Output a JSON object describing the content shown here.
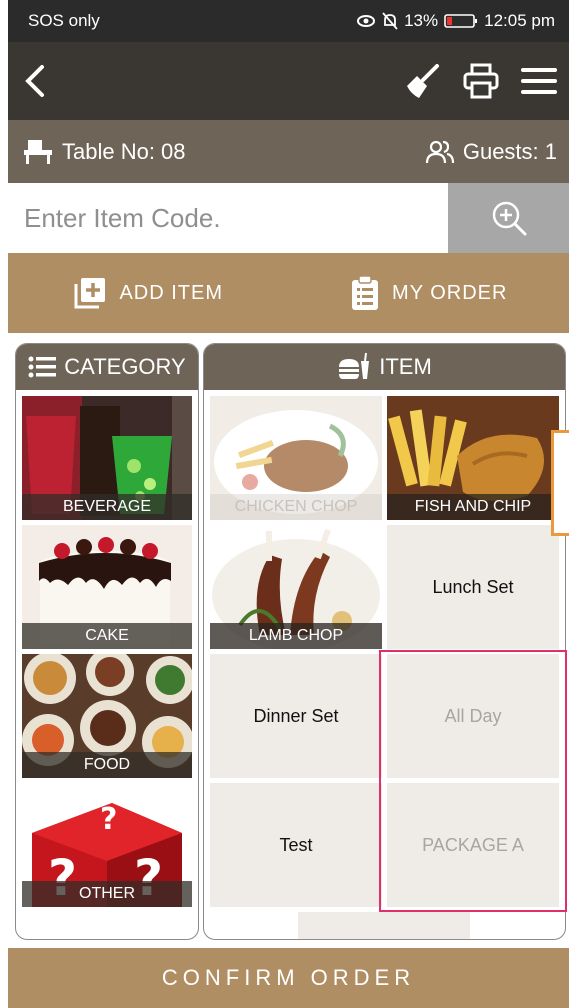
{
  "status_bar": {
    "carrier": "SOS only",
    "battery": "13%",
    "time": "12:05 pm"
  },
  "header": {
    "table_label": "Table No: 08",
    "guests_label": "Guests: 1"
  },
  "search": {
    "placeholder": "Enter Item Code."
  },
  "tabs": [
    {
      "label": "ADD ITEM",
      "active": true
    },
    {
      "label": "MY ORDER",
      "active": false
    }
  ],
  "category_panel": {
    "title": "CATEGORY",
    "items": [
      {
        "label": "BEVERAGE"
      },
      {
        "label": "CAKE"
      },
      {
        "label": "FOOD"
      },
      {
        "label": "OTHER"
      }
    ]
  },
  "item_panel": {
    "title": "ITEM",
    "items": [
      {
        "label": "CHICKEN CHOP"
      },
      {
        "label": "FISH AND CHIP"
      },
      {
        "label": "LAMB CHOP"
      },
      {
        "label": "Lunch Set"
      },
      {
        "label": "Dinner Set"
      },
      {
        "label": "All Day"
      },
      {
        "label": "Test"
      },
      {
        "label": "PACKAGE A"
      }
    ]
  },
  "footer": {
    "confirm_label": "CONFIRM ORDER"
  },
  "colors": {
    "accent": "#b08e64",
    "header_dark": "#3a3632",
    "bar_brown": "#6e6457",
    "highlight": "#e0306a"
  }
}
